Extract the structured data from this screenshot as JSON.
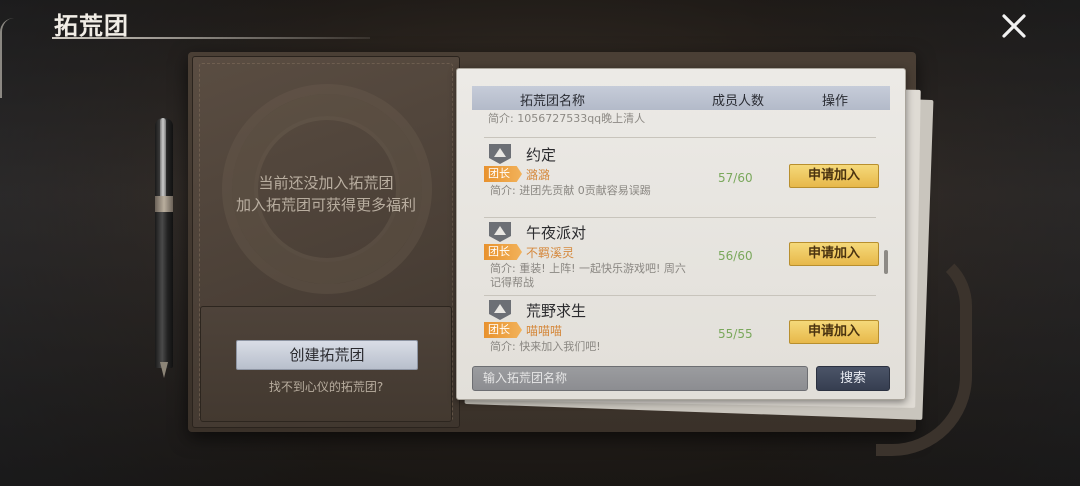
{
  "header": {
    "title": "拓荒团"
  },
  "left_panel": {
    "no_group_line1": "当前还没加入拓荒团",
    "no_group_line2": "加入拓荒团可获得更多福利",
    "create_button": "创建拓荒团",
    "cant_find_link": "找不到心仪的拓荒团?"
  },
  "table": {
    "columns": [
      "拓荒团名称",
      "成员人数",
      "操作"
    ],
    "partial_intro": "简介: 1056727533qq晚上清人",
    "leader_label": "团长",
    "rows": [
      {
        "name": "约定",
        "leader": "潞潞",
        "intro": "简介: 进团先贡献 0贡献容易误踢",
        "members": "57/60",
        "action": "申请加入"
      },
      {
        "name": "午夜派对",
        "leader": "不羁溪灵",
        "intro": "简介: 重装! 上阵! 一起快乐游戏吧! 周六记得帮战",
        "members": "56/60",
        "action": "申请加入"
      },
      {
        "name": "荒野求生",
        "leader": "喵喵喵",
        "intro": "简介: 快来加入我们吧!",
        "members": "55/55",
        "action": "申请加入"
      }
    ]
  },
  "search": {
    "placeholder": "输入拓荒团名称",
    "button": "搜索"
  },
  "icons": [
    "close-icon",
    "guild-emblem-icon",
    "pen-decoration",
    "strap-decoration"
  ],
  "colors": {
    "join_button": "#e7b84a",
    "leader_tag": "#e8922e",
    "member_count": "#7aa85c",
    "search_button": "#3b4356"
  }
}
